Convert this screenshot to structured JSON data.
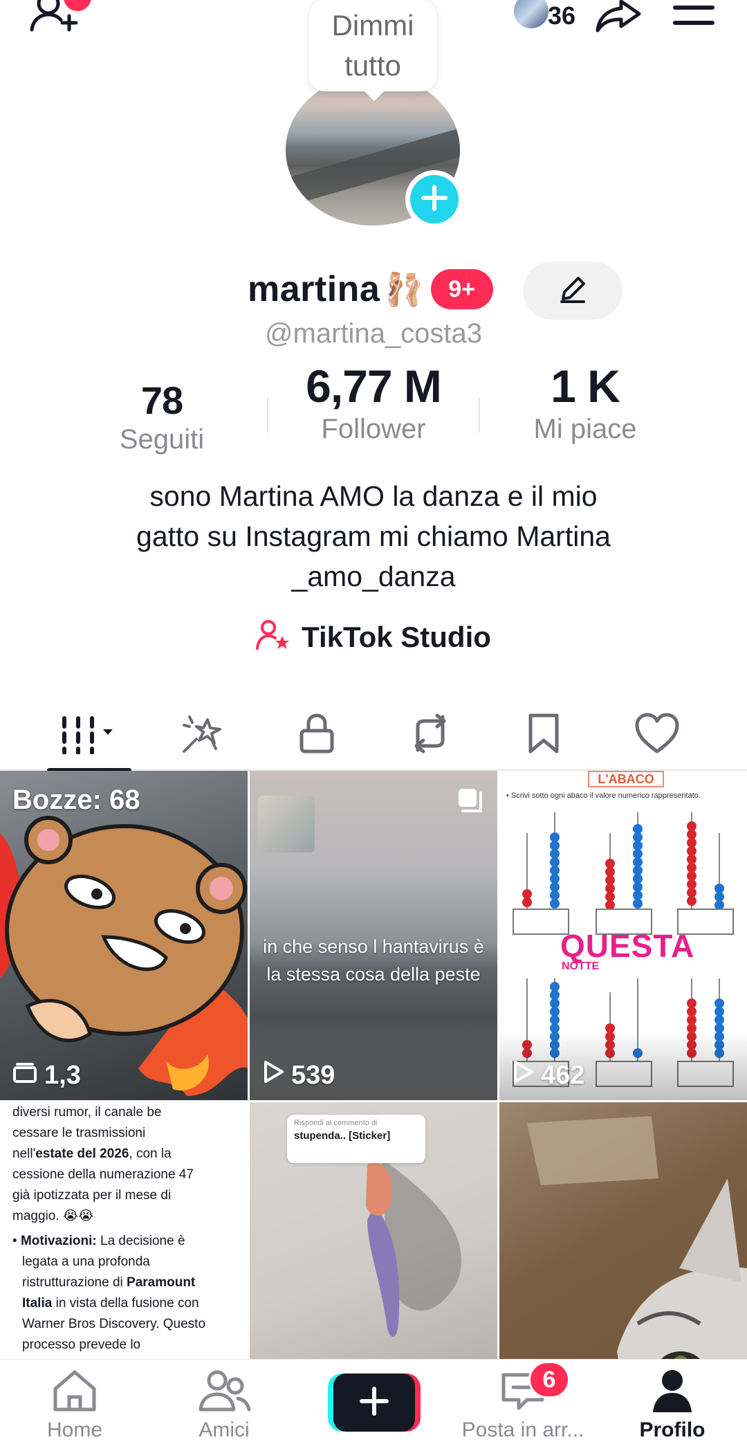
{
  "top_bar": {
    "friend_count": "36",
    "icons": [
      "add-friend-icon",
      "share-icon",
      "menu-icon"
    ]
  },
  "profile": {
    "bubble_text_1": "Dimmi",
    "bubble_text_2": "tutto",
    "name": "martina",
    "name_emoji": "🩰",
    "notification_badge": "9+",
    "handle": "@martina_costa3",
    "stats": {
      "following_value": "78",
      "following_label": "Seguiti",
      "followers_value": "6,77 M",
      "followers_label": "Follower",
      "likes_value": "1 K",
      "likes_label": "Mi piace"
    },
    "bio_line1": "sono Martina AMO la danza e il mio",
    "bio_line2": "gatto su Instagram mi chiamo Martina",
    "bio_line3": "_amo_danza",
    "studio_label": "TikTok Studio"
  },
  "tabs": [
    "videos-tab",
    "reposts-spark-tab",
    "private-tab",
    "reposts-tab",
    "favorites-tab",
    "liked-tab"
  ],
  "grid": {
    "drafts_label": "Bozze: 68",
    "cell1_views": "1,3",
    "cell2_caption": "in che senso l hantavirus è la stessa cosa della peste",
    "cell2_views": "539",
    "cell3_title": "L'ABACO",
    "cell3_subtitle": "• Scrivi sotto ogni abaco il valore numerico rappresentato.",
    "cell3_overlay": "QUESTA",
    "cell3_overlay_small": "NOTTE",
    "cell3_views": "462",
    "cell4_text_a": "diversi rumor, il canale",
    "cell4_text_b": "be",
    "cell4_text_c": "cessare le trasmissioni",
    "cell4_text_d": "nell'",
    "cell4_text_e": "estate del 2026",
    "cell4_text_f": ", con la",
    "cell4_text_g": "cessione della numerazione 47",
    "cell4_text_h": "già ipotizzata per il mese di",
    "cell4_text_i": "maggio. 😭😭",
    "cell4_text_j": "Motivazioni:",
    "cell4_text_k": " La decisione è",
    "cell4_text_l": "legata a una profonda",
    "cell4_text_m": "ristrutturazione di ",
    "cell4_text_n": "Paramount",
    "cell4_text_o": "Italia",
    "cell4_text_p": " in vista della fusione con",
    "cell4_text_q": "Warner Bros Discovery. Questo",
    "cell4_text_r": "processo prevede lo",
    "cell5_reply_line1": "Rispondi al commento di",
    "cell5_reply_line2": "stupenda.. [Sticker]"
  },
  "bottom_nav": {
    "home_label": "Home",
    "friends_label": "Amici",
    "inbox_label": "Posta in arr...",
    "inbox_badge": "6",
    "profile_label": "Profilo"
  },
  "colors": {
    "accent_red": "#fe2c55",
    "accent_cyan": "#25f4ee",
    "avatar_add": "#20d5ec",
    "text_primary": "#161823",
    "text_secondary": "#8a8b91"
  }
}
